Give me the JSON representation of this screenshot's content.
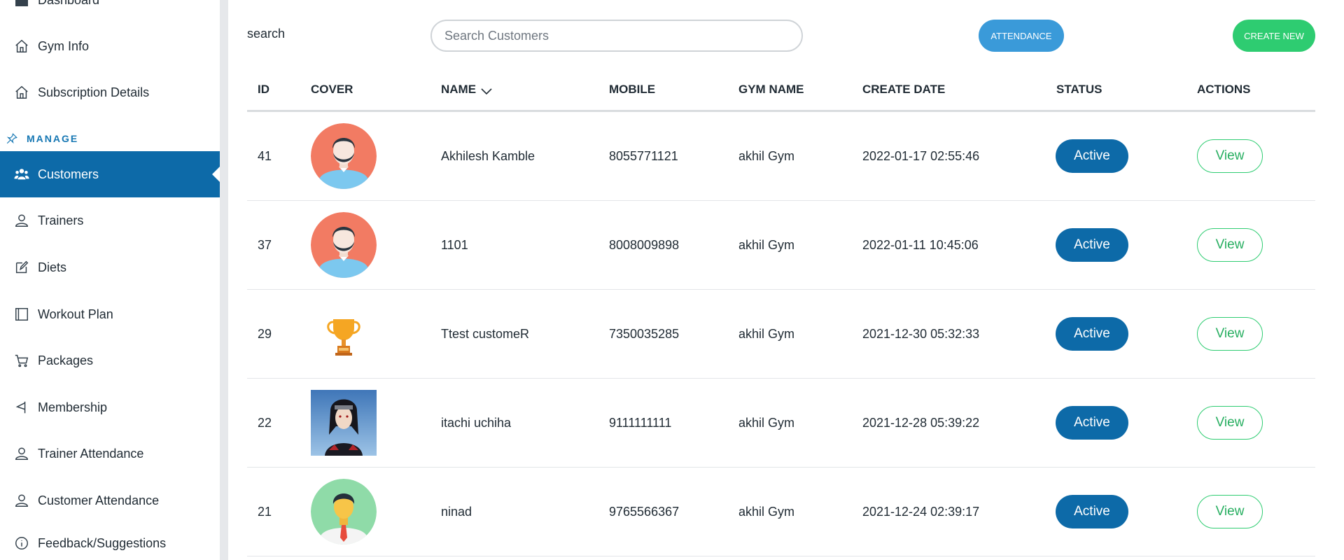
{
  "sidebar": {
    "items_top": [
      {
        "label": "Dashboard",
        "icon": "home-icon"
      },
      {
        "label": "Gym Info",
        "icon": "building-icon"
      },
      {
        "label": "Subscription Details",
        "icon": "building-icon"
      }
    ],
    "section_label": "MANAGE",
    "items": [
      {
        "label": "Customers",
        "icon": "users-icon",
        "active": true
      },
      {
        "label": "Trainers",
        "icon": "user-icon"
      },
      {
        "label": "Diets",
        "icon": "edit-icon"
      },
      {
        "label": "Workout Plan",
        "icon": "notebook-icon"
      },
      {
        "label": "Packages",
        "icon": "cart-icon"
      },
      {
        "label": "Membership",
        "icon": "flag-icon"
      },
      {
        "label": "Trainer Attendance",
        "icon": "user-icon"
      },
      {
        "label": "Customer Attendance",
        "icon": "user-icon"
      },
      {
        "label": "Feedback/Suggestions",
        "icon": "info-icon"
      }
    ],
    "accent_color": "#0d6aa8"
  },
  "toolbar": {
    "search_label": "search",
    "search_placeholder": "Search Customers",
    "search_value": "",
    "attendance_label": "ATTENDANCE",
    "create_label": "CREATE NEW"
  },
  "table": {
    "columns": [
      "ID",
      "COVER",
      "NAME",
      "MOBILE",
      "GYM NAME",
      "CREATE DATE",
      "STATUS",
      "ACTIONS"
    ],
    "rows": [
      {
        "id": "41",
        "cover": "man-avatar-coral",
        "name": "Akhilesh Kamble",
        "mobile": "8055771121",
        "gym": "akhil Gym",
        "date": "2022-01-17 02:55:46",
        "status": "Active",
        "action": "View"
      },
      {
        "id": "37",
        "cover": "man-avatar-coral",
        "name": "1101",
        "mobile": "8008009898",
        "gym": "akhil Gym",
        "date": "2022-01-11 10:45:06",
        "status": "Active",
        "action": "View"
      },
      {
        "id": "29",
        "cover": "trophy-icon",
        "name": "Ttest customeR",
        "mobile": "7350035285",
        "gym": "akhil Gym",
        "date": "2021-12-30 05:32:33",
        "status": "Active",
        "action": "View"
      },
      {
        "id": "22",
        "cover": "anime-photo",
        "name": "itachi uchiha",
        "mobile": "9111111111",
        "gym": "akhil Gym",
        "date": "2021-12-28 05:39:22",
        "status": "Active",
        "action": "View"
      },
      {
        "id": "21",
        "cover": "man-avatar-green",
        "name": "ninad",
        "mobile": "9765566367",
        "gym": "akhil Gym",
        "date": "2021-12-24 02:39:17",
        "status": "Active",
        "action": "View"
      }
    ]
  },
  "colors": {
    "primary": "#0d6aa8",
    "attendance": "#3a9ad9",
    "create": "#2ecc71"
  }
}
